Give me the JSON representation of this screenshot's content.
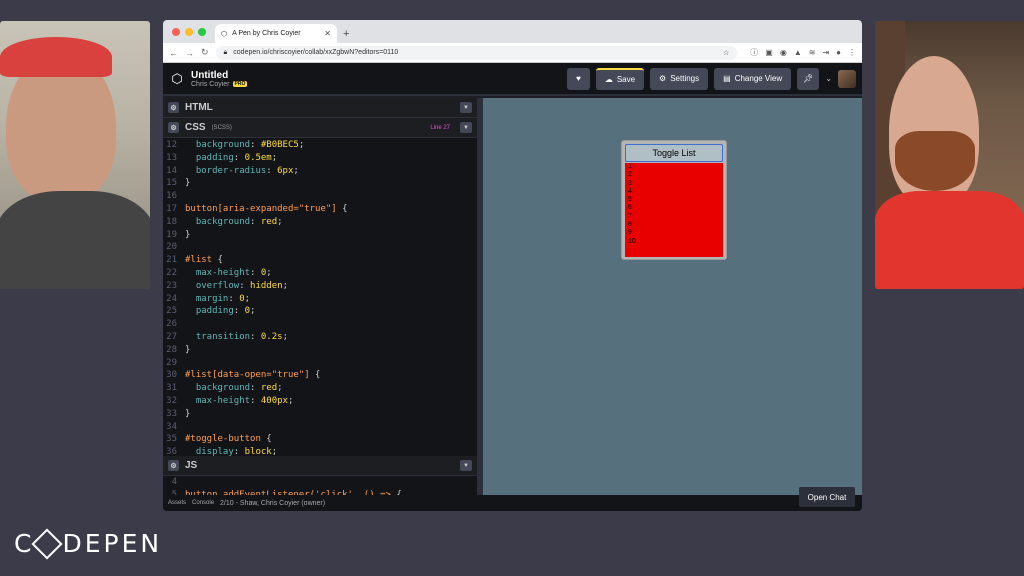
{
  "browser": {
    "tab_title": "A Pen by Chris Coyier",
    "url": "codepen.io/chriscoyier/collab/xxZgbwN?editors=0110"
  },
  "header": {
    "pen_title": "Untitled",
    "owner": "Chris Coyier",
    "pro_badge": "PRO",
    "save_label": "Save",
    "settings_label": "Settings",
    "change_view_label": "Change View"
  },
  "html_panel": {
    "label": "HTML"
  },
  "css_panel": {
    "label": "CSS",
    "preprocessor": "(SCSS)",
    "line_indicator": "Line 27"
  },
  "js_panel": {
    "label": "JS"
  },
  "css_lines": [
    {
      "n": "12",
      "text": "  background: #B0BEC5;"
    },
    {
      "n": "13",
      "text": "  padding: 0.5em;"
    },
    {
      "n": "14",
      "text": "  border-radius: 6px;"
    },
    {
      "n": "15",
      "text": "}"
    },
    {
      "n": "16",
      "text": ""
    },
    {
      "n": "17",
      "text": "button[aria-expanded=\"true\"] {"
    },
    {
      "n": "18",
      "text": "  background: red;"
    },
    {
      "n": "19",
      "text": "}"
    },
    {
      "n": "20",
      "text": ""
    },
    {
      "n": "21",
      "text": "#list {"
    },
    {
      "n": "22",
      "text": "  max-height: 0;"
    },
    {
      "n": "23",
      "text": "  overflow: hidden;"
    },
    {
      "n": "24",
      "text": "  margin: 0;"
    },
    {
      "n": "25",
      "text": "  padding: 0;"
    },
    {
      "n": "26",
      "text": ""
    },
    {
      "n": "27",
      "text": "  transition: 0.2s;"
    },
    {
      "n": "28",
      "text": "}"
    },
    {
      "n": "29",
      "text": ""
    },
    {
      "n": "30",
      "text": "#list[data-open=\"true\"] {"
    },
    {
      "n": "31",
      "text": "  background: red;"
    },
    {
      "n": "32",
      "text": "  max-height: 400px;"
    },
    {
      "n": "33",
      "text": "}"
    },
    {
      "n": "34",
      "text": ""
    },
    {
      "n": "35",
      "text": "#toggle-button {"
    },
    {
      "n": "36",
      "text": "  display: block;"
    }
  ],
  "js_lines": [
    {
      "n": "4",
      "text": ""
    },
    {
      "n": "5",
      "text": "button.addEventListener('click', () => {"
    }
  ],
  "preview": {
    "toggle_label": "Toggle List",
    "list_items": [
      "1",
      "2",
      "3",
      "4",
      "5",
      "6",
      "7",
      "8",
      "9",
      "10"
    ]
  },
  "footer": {
    "assets": "Assets",
    "console": "Console",
    "collaborators": "2/10 - Shaw, Chris Coyier (owner)",
    "open_chat": "Open Chat"
  },
  "brand": {
    "left": "C",
    "right": "DEPEN"
  },
  "colors": {
    "preview_bg": "#56707e",
    "list_red": "#e80000",
    "accent": "#ffdd40"
  }
}
